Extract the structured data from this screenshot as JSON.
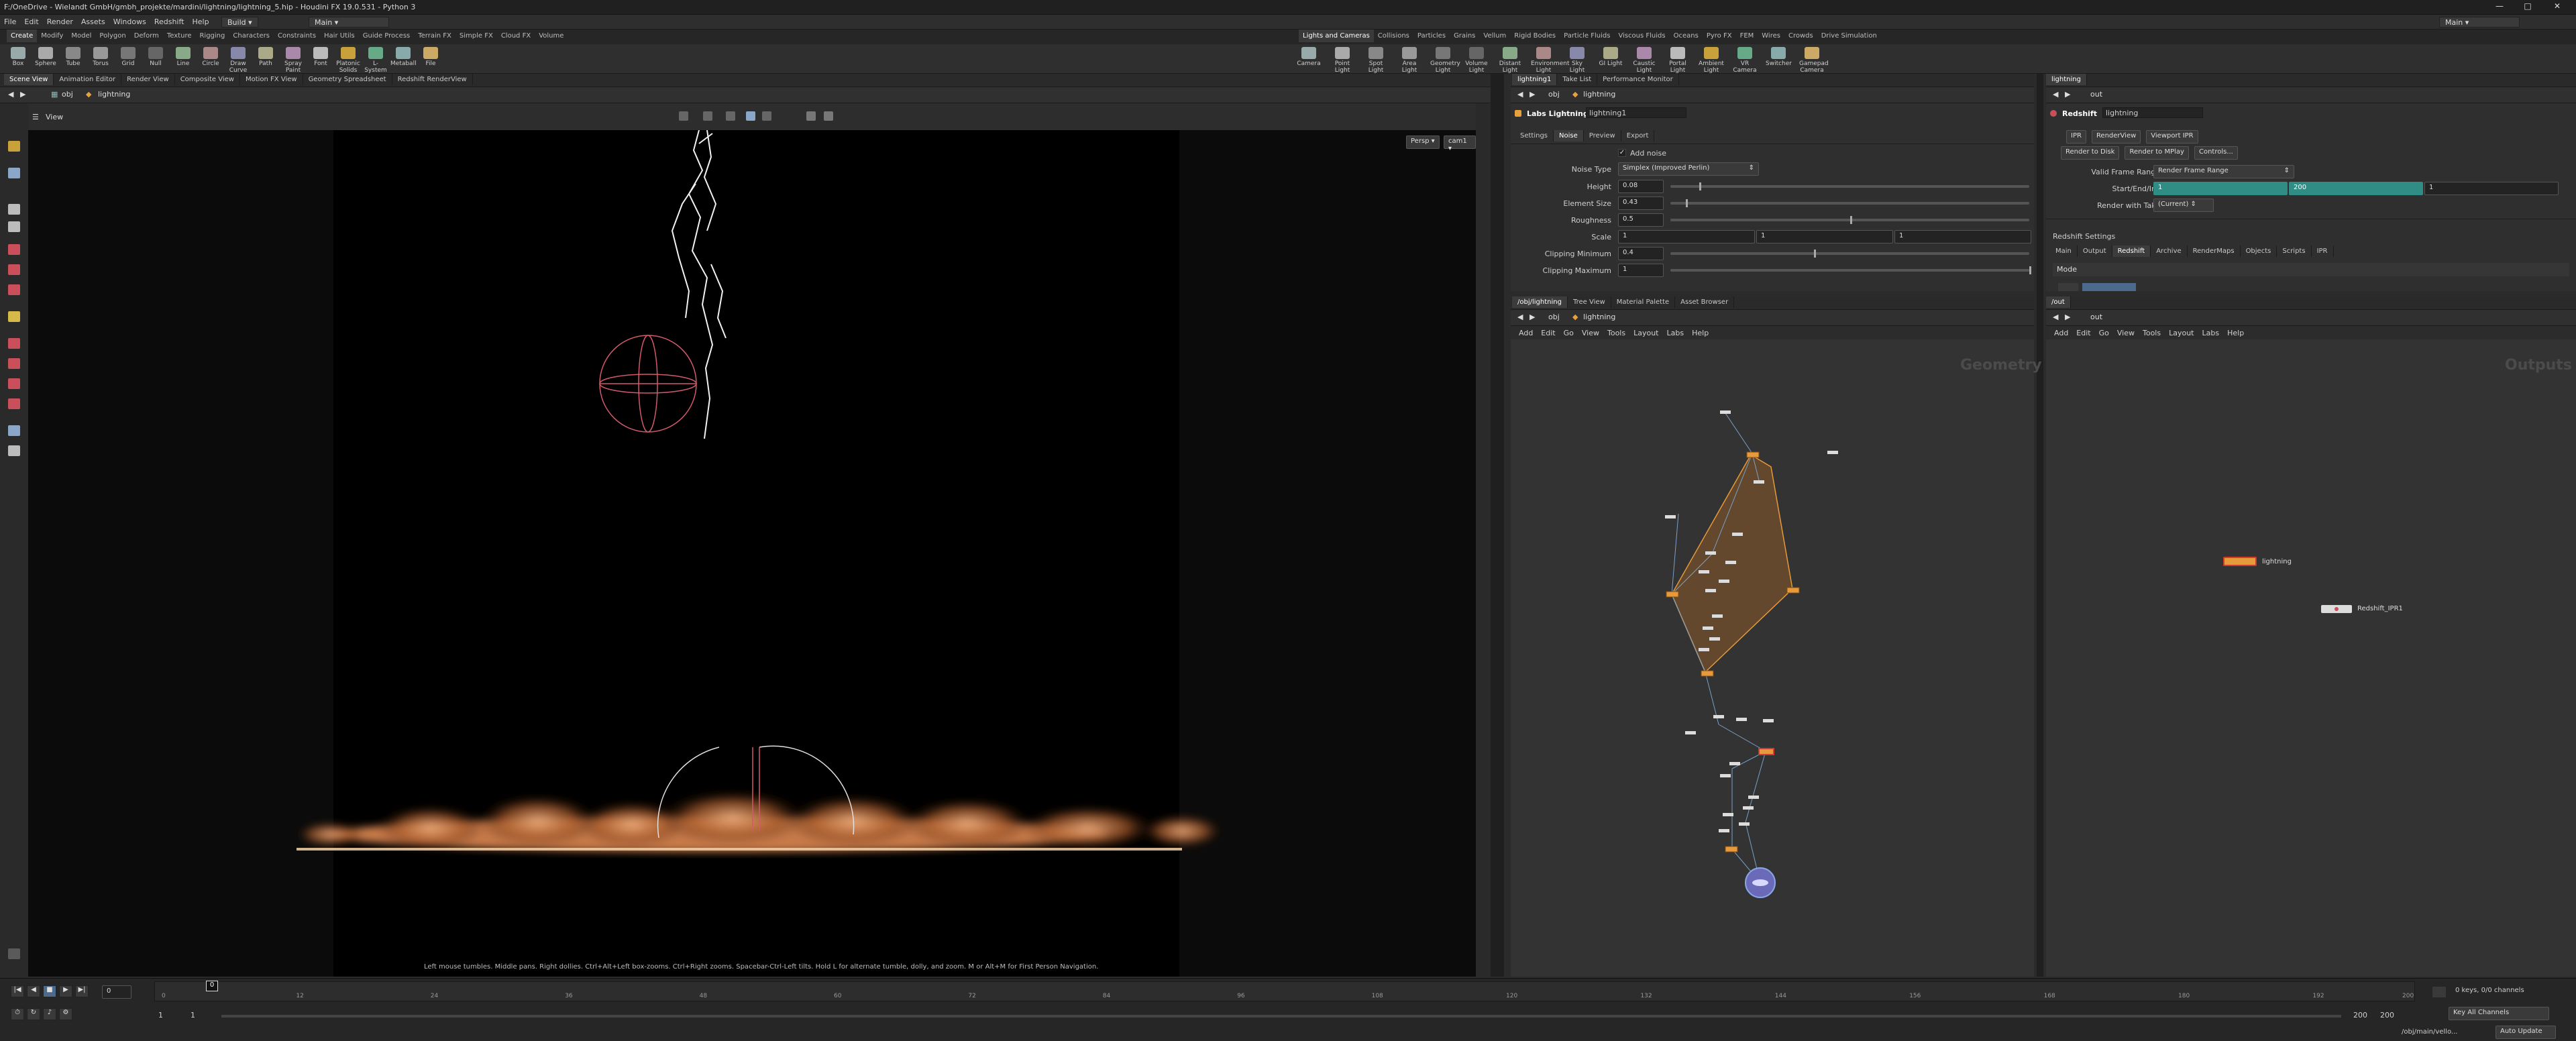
{
  "window": {
    "title": "F:/OneDrive - Wielandt GmbH/gmbh_projekte/mardini/lightning/lightning_5.hip - Houdini FX 19.0.531 - Python 3",
    "desktop": "Build",
    "desktop_right": "Main"
  },
  "menubar": [
    "File",
    "Edit",
    "Render",
    "Assets",
    "Windows",
    "Redshift",
    "Help"
  ],
  "desktop_tab": "Main",
  "shelf_tabs_left": [
    "Create",
    "Modify",
    "Model",
    "Polygon",
    "Deform",
    "Texture",
    "Rigging",
    "Characters",
    "Constraints",
    "Hair Utils",
    "Guide Process",
    "Terrain FX",
    "Simple FX",
    "Cloud FX",
    "Volume"
  ],
  "shelf_tools_left": [
    "Box",
    "Sphere",
    "Tube",
    "Torus",
    "Grid",
    "Null",
    "Line",
    "Circle",
    "Draw Curve",
    "Path",
    "Spray Paint",
    "Font",
    "Platonic Solids",
    "L-System",
    "Metaball",
    "File"
  ],
  "shelf_tabs_right": [
    "Lights and Cameras",
    "Collisions",
    "Particles",
    "Grains",
    "Vellum",
    "Rigid Bodies",
    "Particle Fluids",
    "Viscous Fluids",
    "Oceans",
    "Pyro FX",
    "FEM",
    "Wires",
    "Crowds",
    "Drive Simulation"
  ],
  "shelf_tools_right": [
    "Camera",
    "Point Light",
    "Spot Light",
    "Area Light",
    "Geometry Light",
    "Volume Light",
    "Distant Light",
    "Environment Light",
    "Sky Light",
    "GI Light",
    "Caustic Light",
    "Portal Light",
    "Ambient Light",
    "VR Camera",
    "Switcher",
    "Gamepad Camera"
  ],
  "viewer": {
    "tabs": [
      "Scene View",
      "Animation Editor",
      "Render View",
      "Composite View",
      "Motion FX View",
      "Geometry Spreadsheet",
      "Redshift RenderView"
    ],
    "path": [
      "obj",
      "lightning"
    ],
    "view_label": "View",
    "persp": "Persp",
    "cam": "cam1",
    "hint": "Left mouse tumbles. Middle pans. Right dollies. Ctrl+Alt+Left box-zooms. Ctrl+Right zooms. Spacebar-Ctrl-Left tilts. Hold L for alternate tumble, dolly, and zoom.    M or Alt+M for First Person Navigation."
  },
  "params": {
    "tabs": [
      "lightning1",
      "Take List",
      "Performance Monitor"
    ],
    "path": [
      "obj",
      "lightning"
    ],
    "node_type": "Labs Lightning",
    "node_name": "lightning1",
    "subtabs": [
      "Settings",
      "Noise",
      "Preview",
      "Export"
    ],
    "add_noise_label": "Add noise",
    "noise_type_label": "Noise Type",
    "noise_type": "Simplex (Improved Perlin)",
    "height_label": "Height",
    "height": "0.08",
    "height_frac": 0.08,
    "element_size_label": "Element Size",
    "element_size": "0.43",
    "element_size_frac": 0.043,
    "roughness_label": "Roughness",
    "roughness": "0.5",
    "roughness_frac": 0.5,
    "scale_label": "Scale",
    "scale": [
      "1",
      "1",
      "1"
    ],
    "clip_min_label": "Clipping Minimum",
    "clip_min": "0.4",
    "clip_min_frac": 0.4,
    "clip_max_label": "Clipping Maximum",
    "clip_max": "1",
    "clip_max_frac": 1.0
  },
  "rs": {
    "tab": "lightning",
    "path": "out",
    "node_type": "Redshift",
    "node_name": "lightning",
    "top_tabs": [
      "IPR",
      "RenderView",
      "Viewport IPR"
    ],
    "btns": [
      "Render to Disk",
      "Render to MPlay",
      "Controls..."
    ],
    "valid_frame_range_label": "Valid Frame Range",
    "valid_frame_range": "Render Frame Range",
    "start_end_label": "Start/End/Inc",
    "start": "1",
    "end": "200",
    "inc": "1",
    "render_with_take_label": "Render with Take",
    "render_with_take": "(Current)",
    "settings_label": "Redshift Settings",
    "subtabs": [
      "Main",
      "Output",
      "Redshift",
      "Archive",
      "RenderMaps",
      "Objects",
      "Scripts",
      "IPR"
    ],
    "mode_label": "Mode"
  },
  "network_geo": {
    "tabs": [
      "/obj/lightning",
      "Tree View",
      "Material Palette",
      "Asset Browser"
    ],
    "path": [
      "obj",
      "lightning"
    ],
    "menu": [
      "Add",
      "Edit",
      "Go",
      "View",
      "Tools",
      "Layout",
      "Labs",
      "Help"
    ],
    "context": "Geometry"
  },
  "network_out": {
    "tabs": [
      "/out"
    ],
    "path": "out",
    "menu": [
      "Add",
      "Edit",
      "Go",
      "View",
      "Tools",
      "Layout",
      "Labs",
      "Help"
    ],
    "context": "Outputs",
    "nodes": [
      "lightning",
      "Redshift_IPR1"
    ]
  },
  "timeline": {
    "frame": "0",
    "start": "1",
    "start2": "1",
    "end": "200",
    "end2": "200",
    "keys": "0 keys, 0/0 channels",
    "key_all": "Key All Channels",
    "auto_update": "Auto Update",
    "status_path": "/obj/main/vello...",
    "ticks": [
      "0",
      "12",
      "24",
      "36",
      "48",
      "60",
      "72",
      "84",
      "96",
      "108",
      "120",
      "132",
      "144",
      "156",
      "168",
      "180",
      "192",
      "200"
    ]
  }
}
